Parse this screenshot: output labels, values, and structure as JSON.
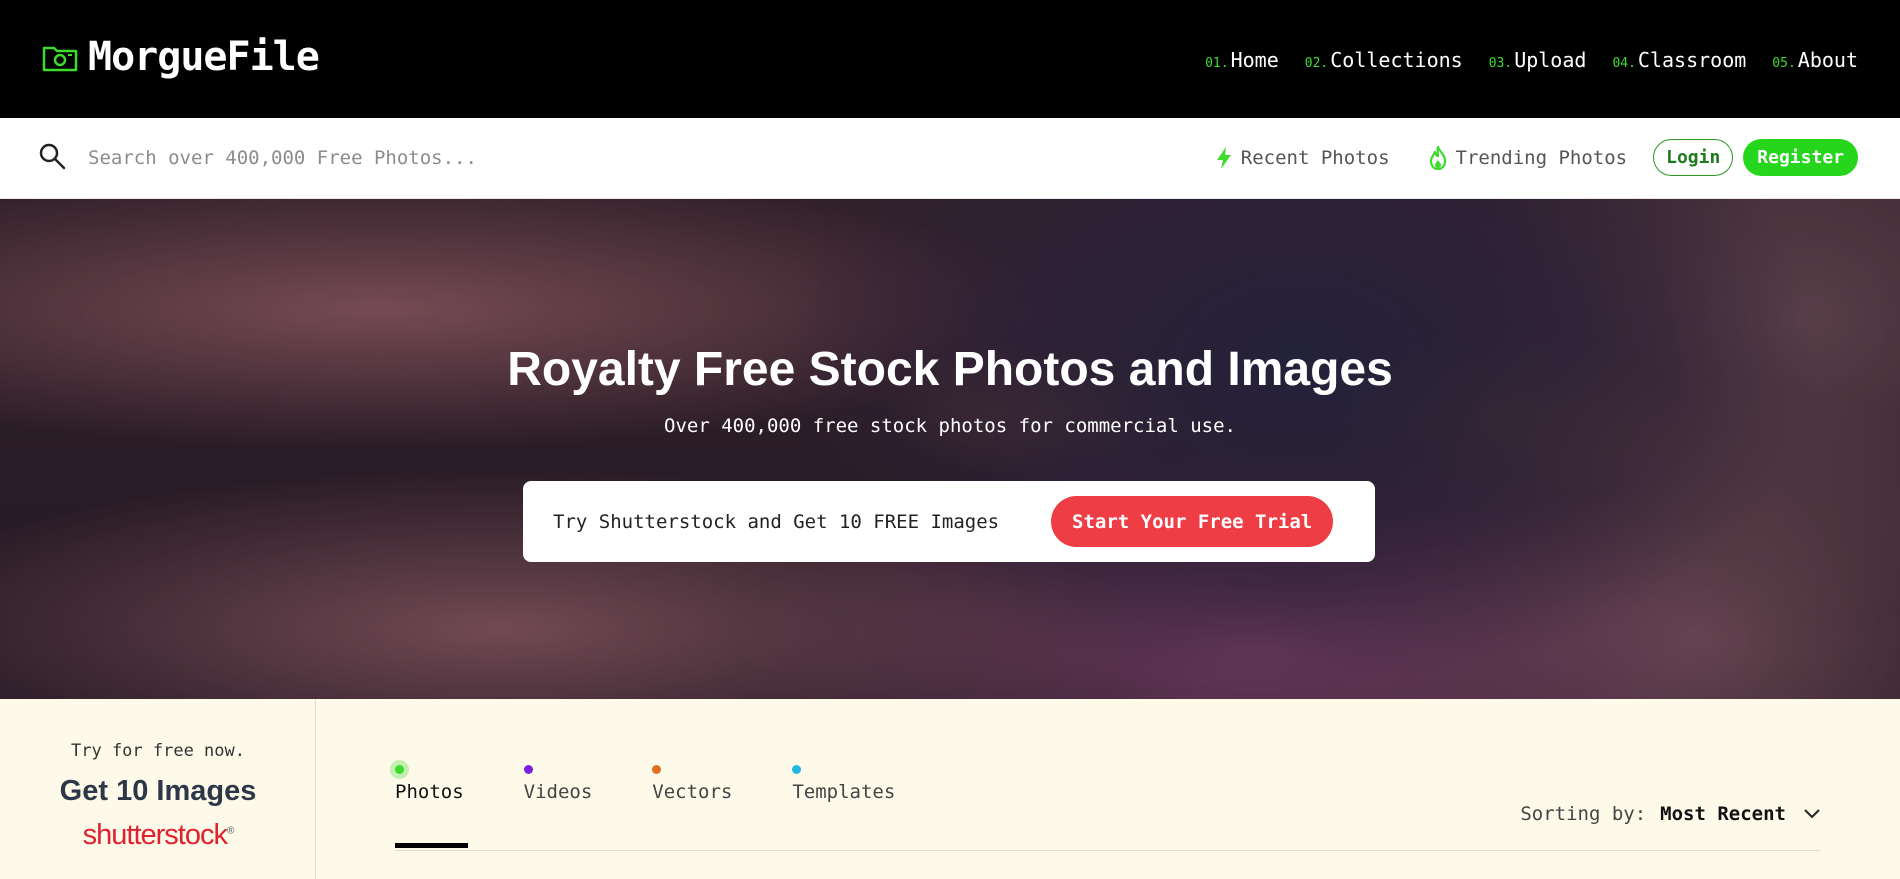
{
  "header": {
    "logo_text": "MorgueFile",
    "nav": [
      {
        "num": "01.",
        "label": "Home"
      },
      {
        "num": "02.",
        "label": "Collections"
      },
      {
        "num": "03.",
        "label": "Upload"
      },
      {
        "num": "04.",
        "label": "Classroom"
      },
      {
        "num": "05.",
        "label": "About"
      }
    ]
  },
  "searchbar": {
    "placeholder": "Search over 400,000 Free Photos...",
    "recent_label": "Recent Photos",
    "trending_label": "Trending Photos",
    "login_label": "Login",
    "register_label": "Register"
  },
  "hero": {
    "title": "Royalty Free Stock Photos and Images",
    "subtitle": "Over 400,000 free stock photos for commercial use.",
    "promo_text": "Try Shutterstock and Get 10 FREE Images",
    "promo_button": "Start Your Free Trial"
  },
  "sidebar_ad": {
    "small_text": "Try for free now.",
    "headline": "Get 10 Images",
    "brand": "shutterstock"
  },
  "content_tabs": [
    {
      "label": "Photos",
      "dot_color": "#3ddc2c",
      "active": true
    },
    {
      "label": "Videos",
      "dot_color": "#7b1fe0",
      "active": false
    },
    {
      "label": "Vectors",
      "dot_color": "#e0701f",
      "active": false
    },
    {
      "label": "Templates",
      "dot_color": "#1fb8e0",
      "active": false
    }
  ],
  "sorting": {
    "label": "Sorting by:",
    "value": "Most Recent"
  },
  "colors": {
    "accent_green": "#26d61c",
    "promo_red": "#ee3d45"
  }
}
